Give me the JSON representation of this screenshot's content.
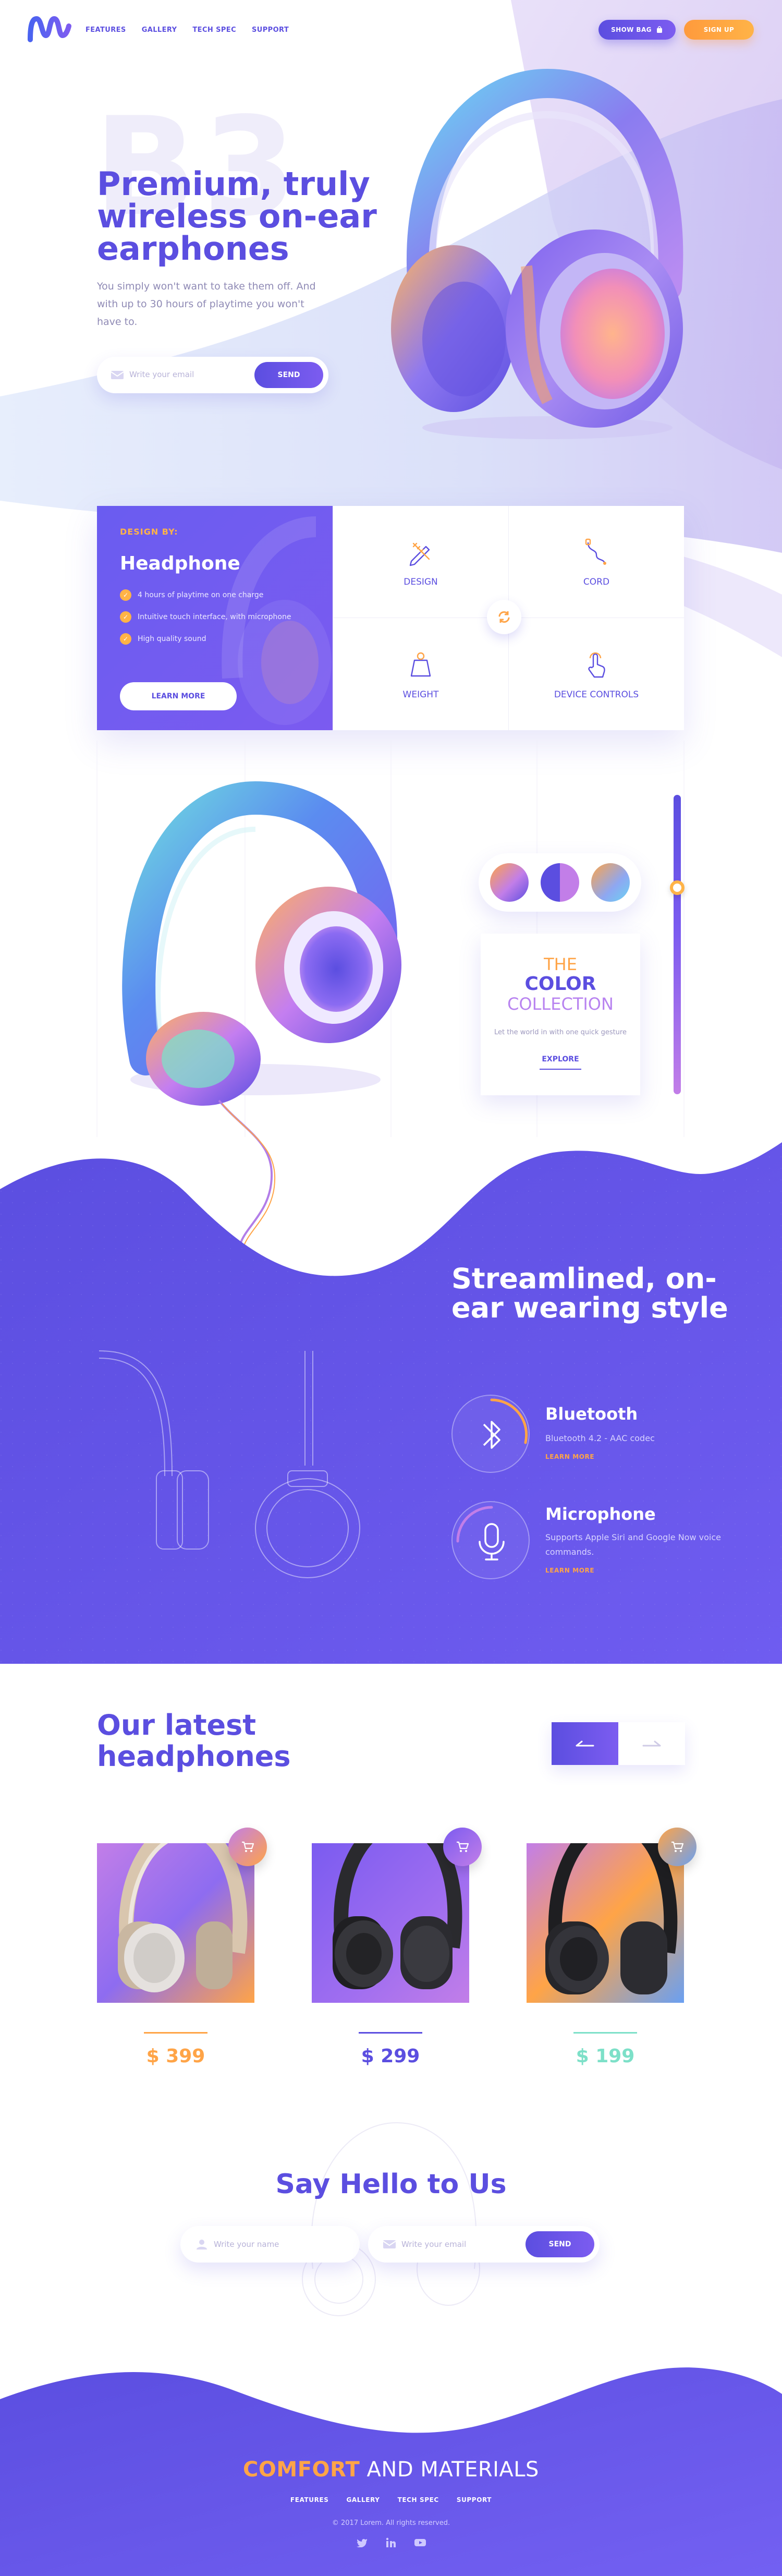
{
  "colors": {
    "primary": "#5b4ee0",
    "accent": "#ffa447",
    "lavender": "#c27ee8",
    "teal": "#7de0c8"
  },
  "header": {
    "nav": [
      "FEATURES",
      "GALLERY",
      "TECH SPEC",
      "SUPPORT"
    ],
    "show_bag": "SHOW BAG",
    "sign_up": "SIGN UP"
  },
  "hero": {
    "watermark": "B3",
    "title": "Premium, truly wireless on-ear earphones",
    "subtitle": "You simply won't want to take them off. And with up to 30 hours of playtime you won't have to.",
    "email_placeholder": "Write your email",
    "send": "SEND"
  },
  "design": {
    "label": "DESIGN BY:",
    "title": "Headphone",
    "features": [
      "4 hours of playtime on one charge",
      "Intuitive touch interface, with microphone",
      "High quality sound"
    ],
    "learn_more": "LEARN MORE",
    "cells": [
      "DESIGN",
      "CORD",
      "WEIGHT",
      "DEVICE CONTROLS"
    ]
  },
  "collection": {
    "line1": "THE",
    "line2": "COLOR",
    "line3": "COLLECTION",
    "description": "Let the world in with one quick gesture",
    "explore": "EXPLORE"
  },
  "streamlined": {
    "title": "Streamlined, on-ear wearing style",
    "features": [
      {
        "title": "Bluetooth",
        "desc": "Bluetooth 4.2 - AAC codec",
        "link": "LEARN MORE",
        "icon": "bluetooth-icon"
      },
      {
        "title": "Microphone",
        "desc": "Supports Apple Siri and Google Now voice commands.",
        "link": "LEARN MORE",
        "icon": "microphone-icon"
      }
    ]
  },
  "products": {
    "title": "Our latest headphones",
    "items": [
      {
        "price": "$ 399",
        "accent": "#ffa447"
      },
      {
        "price": "$ 299",
        "accent": "#5b4ee0"
      },
      {
        "price": "$ 199",
        "accent": "#7de0c8"
      }
    ]
  },
  "contact": {
    "title": "Say Hello to Us",
    "name_placeholder": "Write your name",
    "email_placeholder": "Write your email",
    "send": "SEND"
  },
  "footer": {
    "comfort": "COMFORT",
    "and_materials": " AND MATERIALS",
    "nav": [
      "FEATURES",
      "GALLERY",
      "TECH SPEC",
      "SUPPORT"
    ],
    "copyright": "© 2017 Lorem. All rights reserved.",
    "social": [
      "twitter-icon",
      "linkedin-icon",
      "youtube-icon"
    ]
  }
}
